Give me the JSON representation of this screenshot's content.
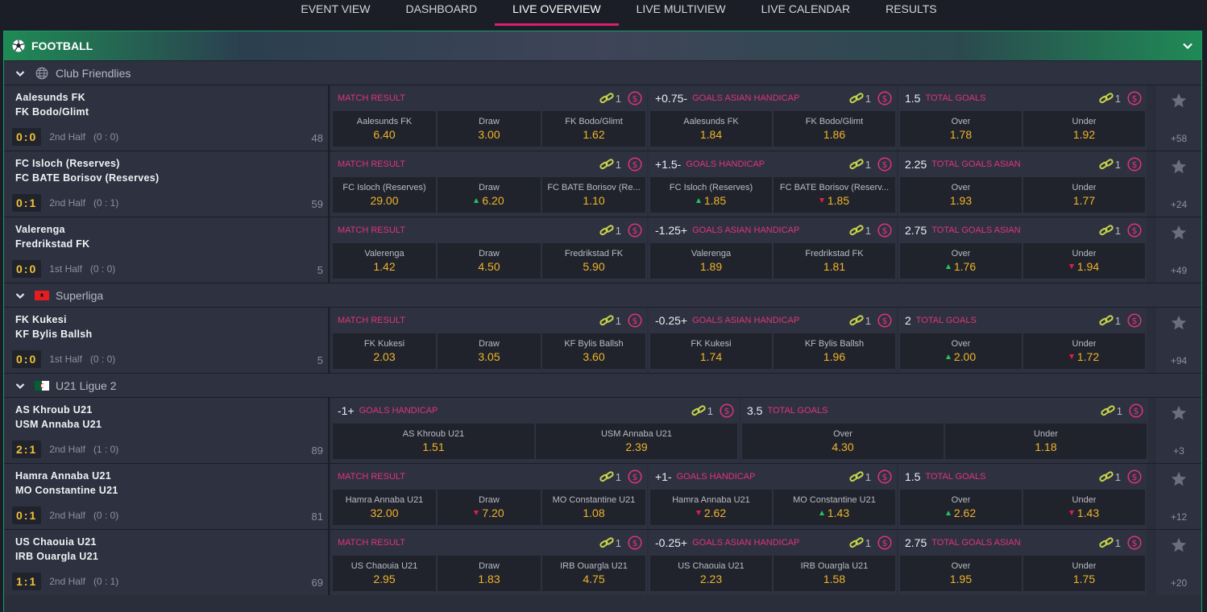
{
  "nav": [
    "EVENT VIEW",
    "DASHBOARD",
    "LIVE OVERVIEW",
    "LIVE MULTIVIEW",
    "LIVE CALENDAR",
    "RESULTS"
  ],
  "nav_active": 2,
  "sport": {
    "title": "FOOTBALL"
  },
  "leagues": [
    {
      "name": "Club Friendlies",
      "flag": "globe-icon",
      "events": [
        {
          "home": "Aalesunds FK",
          "away": "FK Bodo/Glimt",
          "score": "0:0",
          "period": "2nd Half",
          "half": "(0 : 0)",
          "minute": "48",
          "more": "+58",
          "markets": [
            {
              "line": "",
              "name": "MATCH RESULT",
              "count": "1",
              "width": 392,
              "odds": [
                {
                  "label": "Aalesunds FK",
                  "value": "6.40",
                  "trend": ""
                },
                {
                  "label": "Draw",
                  "value": "3.00",
                  "trend": ""
                },
                {
                  "label": "FK Bodo/Glimt",
                  "value": "1.62",
                  "trend": ""
                }
              ]
            },
            {
              "line": "+0.75-",
              "name": "GOALS ASIAN HANDICAP",
              "count": "1",
              "width": 308,
              "odds": [
                {
                  "label": "Aalesunds FK",
                  "value": "1.84",
                  "trend": ""
                },
                {
                  "label": "FK Bodo/Glimt",
                  "value": "1.86",
                  "trend": ""
                }
              ]
            },
            {
              "line": "1.5",
              "name": "TOTAL GOALS",
              "count": "1",
              "width": 308,
              "odds": [
                {
                  "label": "Over",
                  "value": "1.78",
                  "trend": ""
                },
                {
                  "label": "Under",
                  "value": "1.92",
                  "trend": ""
                }
              ]
            }
          ]
        },
        {
          "home": "FC Isloch (Reserves)",
          "away": "FC BATE Borisov (Reserves)",
          "score": "0:1",
          "period": "2nd Half",
          "half": "(0 : 1)",
          "minute": "59",
          "more": "+24",
          "markets": [
            {
              "line": "",
              "name": "MATCH RESULT",
              "count": "1",
              "width": 392,
              "odds": [
                {
                  "label": "FC Isloch (Reserves)",
                  "value": "29.00",
                  "trend": ""
                },
                {
                  "label": "Draw",
                  "value": "6.20",
                  "trend": "up"
                },
                {
                  "label": "FC BATE Borisov (Re...",
                  "value": "1.10",
                  "trend": ""
                }
              ]
            },
            {
              "line": "+1.5-",
              "name": "GOALS HANDICAP",
              "count": "1",
              "width": 308,
              "odds": [
                {
                  "label": "FC Isloch (Reserves)",
                  "value": "1.85",
                  "trend": "up"
                },
                {
                  "label": "FC BATE Borisov (Reserv...",
                  "value": "1.85",
                  "trend": "down"
                }
              ]
            },
            {
              "line": "2.25",
              "name": "TOTAL GOALS ASIAN",
              "count": "1",
              "width": 308,
              "odds": [
                {
                  "label": "Over",
                  "value": "1.93",
                  "trend": ""
                },
                {
                  "label": "Under",
                  "value": "1.77",
                  "trend": ""
                }
              ]
            }
          ]
        },
        {
          "home": "Valerenga",
          "away": "Fredrikstad FK",
          "score": "0:0",
          "period": "1st Half",
          "half": "(0 : 0)",
          "minute": "5",
          "more": "+49",
          "markets": [
            {
              "line": "",
              "name": "MATCH RESULT",
              "count": "1",
              "width": 392,
              "odds": [
                {
                  "label": "Valerenga",
                  "value": "1.42",
                  "trend": ""
                },
                {
                  "label": "Draw",
                  "value": "4.50",
                  "trend": ""
                },
                {
                  "label": "Fredrikstad FK",
                  "value": "5.90",
                  "trend": ""
                }
              ]
            },
            {
              "line": "-1.25+",
              "name": "GOALS ASIAN HANDICAP",
              "count": "1",
              "width": 308,
              "odds": [
                {
                  "label": "Valerenga",
                  "value": "1.89",
                  "trend": ""
                },
                {
                  "label": "Fredrikstad FK",
                  "value": "1.81",
                  "trend": ""
                }
              ]
            },
            {
              "line": "2.75",
              "name": "TOTAL GOALS ASIAN",
              "count": "1",
              "width": 308,
              "odds": [
                {
                  "label": "Over",
                  "value": "1.76",
                  "trend": "up"
                },
                {
                  "label": "Under",
                  "value": "1.94",
                  "trend": "down"
                }
              ]
            }
          ]
        }
      ]
    },
    {
      "name": "Superliga",
      "flag": "albania-flag-icon",
      "events": [
        {
          "home": "FK Kukesi",
          "away": "KF Bylis Ballsh",
          "score": "0:0",
          "period": "1st Half",
          "half": "(0 : 0)",
          "minute": "5",
          "more": "+94",
          "markets": [
            {
              "line": "",
              "name": "MATCH RESULT",
              "count": "1",
              "width": 392,
              "odds": [
                {
                  "label": "FK Kukesi",
                  "value": "2.03",
                  "trend": ""
                },
                {
                  "label": "Draw",
                  "value": "3.05",
                  "trend": ""
                },
                {
                  "label": "KF Bylis Ballsh",
                  "value": "3.60",
                  "trend": ""
                }
              ]
            },
            {
              "line": "-0.25+",
              "name": "GOALS ASIAN HANDICAP",
              "count": "1",
              "width": 308,
              "odds": [
                {
                  "label": "FK Kukesi",
                  "value": "1.74",
                  "trend": ""
                },
                {
                  "label": "KF Bylis Ballsh",
                  "value": "1.96",
                  "trend": ""
                }
              ]
            },
            {
              "line": "2",
              "name": "TOTAL GOALS",
              "count": "1",
              "width": 308,
              "odds": [
                {
                  "label": "Over",
                  "value": "2.00",
                  "trend": "up"
                },
                {
                  "label": "Under",
                  "value": "1.72",
                  "trend": "down"
                }
              ]
            }
          ]
        }
      ]
    },
    {
      "name": "U21 Ligue 2",
      "flag": "algeria-flag-icon",
      "events": [
        {
          "home": "AS Khroub U21",
          "away": "USM Annaba U21",
          "score": "2:1",
          "period": "2nd Half",
          "half": "(1 : 0)",
          "minute": "89",
          "more": "+3",
          "markets": [
            {
              "line": "-1+",
              "name": "GOALS HANDICAP",
              "count": "1",
              "width": 506,
              "odds": [
                {
                  "label": "AS Khroub U21",
                  "value": "1.51",
                  "trend": ""
                },
                {
                  "label": "USM Annaba U21",
                  "value": "2.39",
                  "trend": ""
                }
              ]
            },
            {
              "line": "3.5",
              "name": "TOTAL GOALS",
              "count": "1",
              "width": 506,
              "odds": [
                {
                  "label": "Over",
                  "value": "4.30",
                  "trend": ""
                },
                {
                  "label": "Under",
                  "value": "1.18",
                  "trend": ""
                }
              ]
            }
          ]
        },
        {
          "home": "Hamra Annaba U21",
          "away": "MO Constantine U21",
          "score": "0:1",
          "period": "2nd Half",
          "half": "(0 : 0)",
          "minute": "81",
          "more": "+12",
          "markets": [
            {
              "line": "",
              "name": "MATCH RESULT",
              "count": "1",
              "width": 392,
              "odds": [
                {
                  "label": "Hamra Annaba U21",
                  "value": "32.00",
                  "trend": ""
                },
                {
                  "label": "Draw",
                  "value": "7.20",
                  "trend": "down"
                },
                {
                  "label": "MO Constantine U21",
                  "value": "1.08",
                  "trend": ""
                }
              ]
            },
            {
              "line": "+1-",
              "name": "GOALS HANDICAP",
              "count": "1",
              "width": 308,
              "odds": [
                {
                  "label": "Hamra Annaba U21",
                  "value": "2.62",
                  "trend": "down"
                },
                {
                  "label": "MO Constantine U21",
                  "value": "1.43",
                  "trend": "up"
                }
              ]
            },
            {
              "line": "1.5",
              "name": "TOTAL GOALS",
              "count": "1",
              "width": 308,
              "odds": [
                {
                  "label": "Over",
                  "value": "2.62",
                  "trend": "up"
                },
                {
                  "label": "Under",
                  "value": "1.43",
                  "trend": "down"
                }
              ]
            }
          ]
        },
        {
          "home": "US Chaouia U21",
          "away": "IRB Ouargla U21",
          "score": "1:1",
          "period": "2nd Half",
          "half": "(0 : 1)",
          "minute": "69",
          "more": "+20",
          "markets": [
            {
              "line": "",
              "name": "MATCH RESULT",
              "count": "1",
              "width": 392,
              "odds": [
                {
                  "label": "US Chaouia U21",
                  "value": "2.95",
                  "trend": ""
                },
                {
                  "label": "Draw",
                  "value": "1.83",
                  "trend": ""
                },
                {
                  "label": "IRB Ouargla U21",
                  "value": "4.75",
                  "trend": ""
                }
              ]
            },
            {
              "line": "-0.25+",
              "name": "GOALS ASIAN HANDICAP",
              "count": "1",
              "width": 308,
              "odds": [
                {
                  "label": "US Chaouia U21",
                  "value": "2.23",
                  "trend": ""
                },
                {
                  "label": "IRB Ouargla U21",
                  "value": "1.58",
                  "trend": ""
                }
              ]
            },
            {
              "line": "2.75",
              "name": "TOTAL GOALS ASIAN",
              "count": "1",
              "width": 308,
              "odds": [
                {
                  "label": "Over",
                  "value": "1.95",
                  "trend": ""
                },
                {
                  "label": "Under",
                  "value": "1.75",
                  "trend": ""
                }
              ]
            }
          ]
        }
      ]
    }
  ]
}
